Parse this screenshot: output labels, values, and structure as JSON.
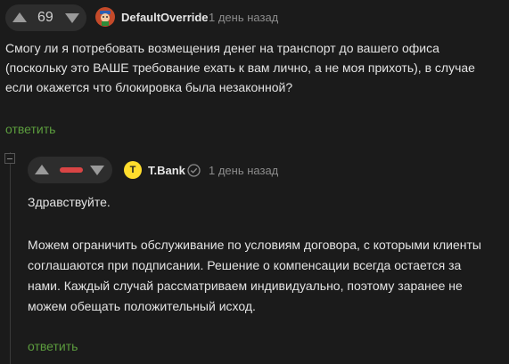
{
  "comment1": {
    "score": "69",
    "author": "DefaultOverride",
    "time": "1 день назад",
    "text_lines": [
      "Смогу ли я потребовать возмещения денег на транспорт до вашего офиса",
      "(поскольку это ВАШЕ требование ехать к вам лично, а не моя прихоть), в случае",
      "если окажется что блокировка была незаконной?"
    ],
    "reply_label": "ответить"
  },
  "comment2": {
    "score_indicator": "negative",
    "author": "T.Bank",
    "avatar_letter": "T",
    "verified": true,
    "time": "1 день назад",
    "greeting": "Здравствуйте.",
    "text_lines": [
      "Можем ограничить обслуживание по условиям договора, с которыми клиенты",
      "соглашаются при подписании. Решение о компенсации всегда остается за",
      "нами. Каждый случай рассматриваем индивидуально, поэтому заранее не",
      "можем обещать положительный исход."
    ],
    "reply_label": "ответить"
  },
  "colors": {
    "background": "#1b1b1b",
    "reply_link": "#5c9d3e",
    "negative_rating": "#d94545",
    "tbank_yellow": "#ffdd2d"
  }
}
